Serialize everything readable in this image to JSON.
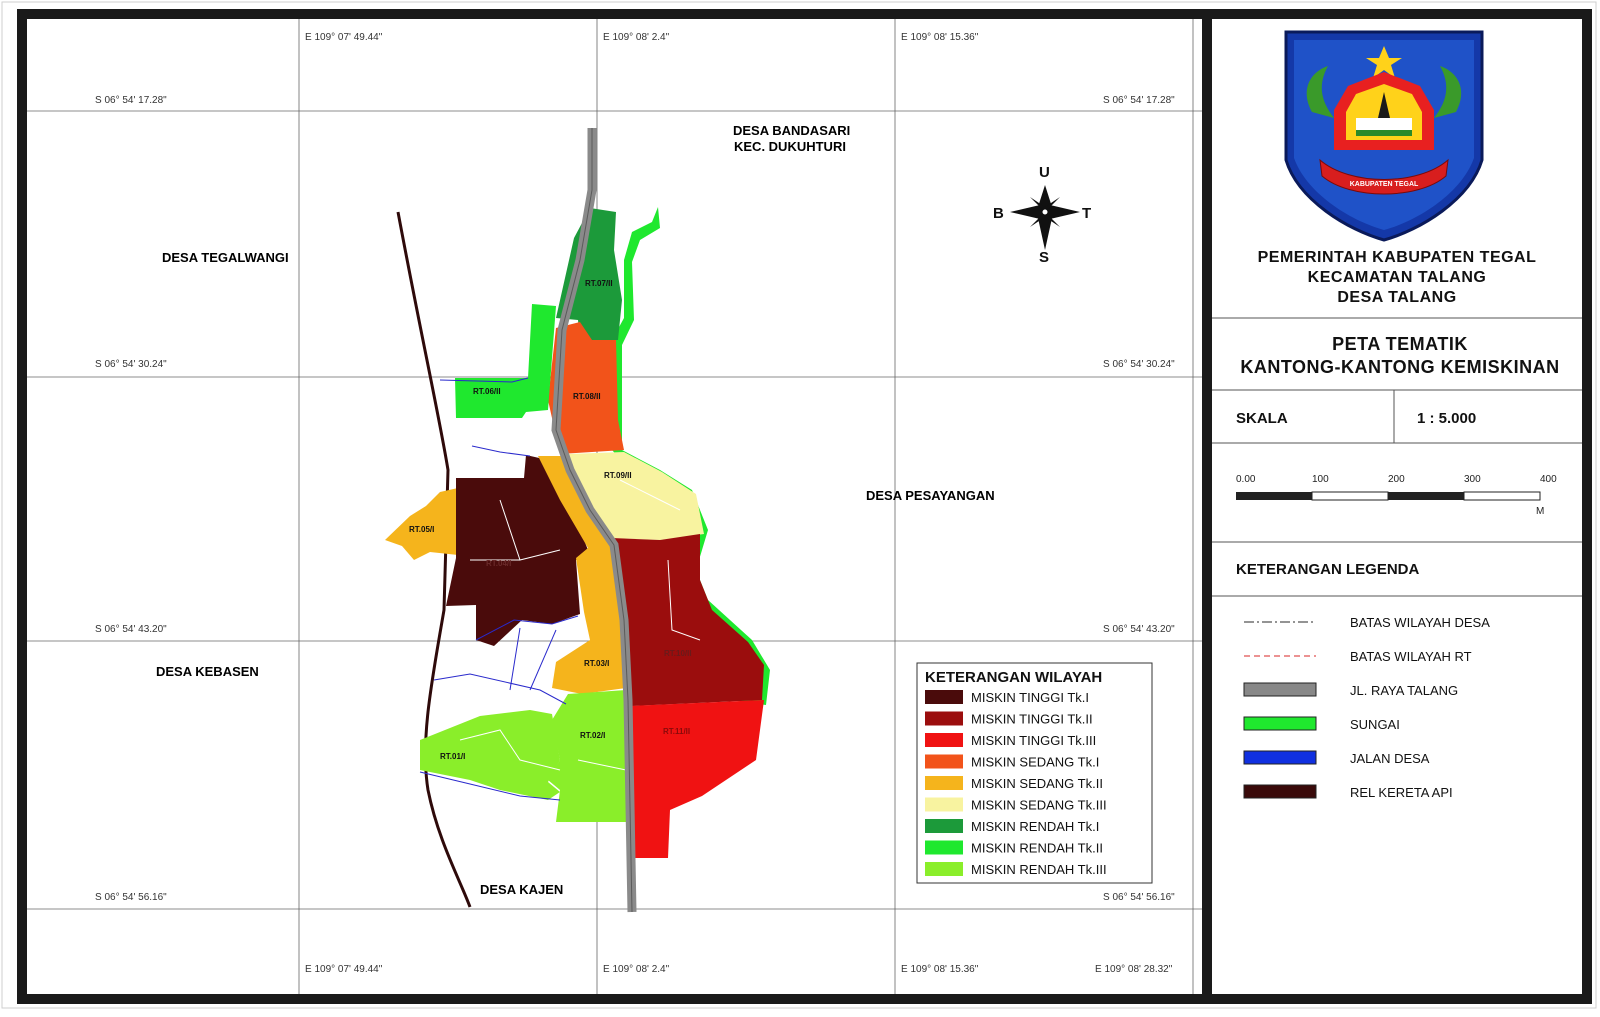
{
  "map": {
    "coordinates": {
      "top_longitudes": [
        "E 109° 07' 49.44\"",
        "E 109° 08' 2.4\"",
        "E 109° 08' 15.36\""
      ],
      "bottom_longitudes": [
        "E 109° 07' 49.44\"",
        "E 109° 08' 2.4\"",
        "E 109° 08' 15.36\"",
        "E 109° 08' 28.32\""
      ],
      "latitudes": [
        "S 06° 54' 17.28\"",
        "S 06° 54' 30.24\"",
        "S 06° 54' 43.20\"",
        "S 06° 54' 56.16\""
      ]
    },
    "villages": {
      "north_line1": "DESA BANDASARI",
      "north_line2": "KEC. DUKUHTURI",
      "west": "DESA TEGALWANGI",
      "east": "DESA PESAYANGAN",
      "southwest": "DESA KEBASEN",
      "south": "DESA KAJEN"
    },
    "rt_labels": {
      "rt07": "RT.07/II",
      "rt08": "RT.08/II",
      "rt06": "RT.06/II",
      "rt09": "RT.09/II",
      "rt05": "RT.05/I",
      "rt04": "RT.04/I",
      "rt10": "RT.10/II",
      "rt03": "RT.03/I",
      "rt11": "RT.11/II",
      "rt02": "RT.02/I",
      "rt01": "RT.01/I"
    },
    "compass": {
      "north": "U",
      "south": "S",
      "west": "B",
      "east": "T"
    }
  },
  "wilayah_legend": {
    "title": "KETERANGAN WILAYAH",
    "items": [
      {
        "label": "MISKIN TINGGI Tk.I",
        "color": "#4a0b0b"
      },
      {
        "label": "MISKIN TINGGI Tk.II",
        "color": "#9b0d0d"
      },
      {
        "label": "MISKIN TINGGI Tk.III",
        "color": "#f01212"
      },
      {
        "label": "MISKIN SEDANG Tk.I",
        "color": "#f2531a"
      },
      {
        "label": "MISKIN SEDANG Tk.II",
        "color": "#f5b41c"
      },
      {
        "label": "MISKIN SEDANG Tk.III",
        "color": "#f8f3a0"
      },
      {
        "label": "MISKIN RENDAH Tk.I",
        "color": "#1c9a3a"
      },
      {
        "label": "MISKIN RENDAH Tk.II",
        "color": "#1fe82e"
      },
      {
        "label": "MISKIN RENDAH Tk.III",
        "color": "#8aee2a"
      }
    ]
  },
  "panel": {
    "gov_line1": "PEMERINTAH KABUPATEN TEGAL",
    "gov_line2": "KECAMATAN TALANG",
    "gov_line3": "DESA TALANG",
    "logo_ribbon": "KABUPATEN TEGAL",
    "map_title_line1": "PETA TEMATIK",
    "map_title_line2": "KANTONG-KANTONG KEMISKINAN",
    "scale_label": "SKALA",
    "scale_value": "1 : 5.000",
    "scale_ticks": [
      "0.00",
      "100",
      "200",
      "300",
      "400"
    ],
    "scale_unit": "M",
    "legend_title": "KETERANGAN LEGENDA",
    "legend_items": [
      {
        "label": "BATAS WILAYAH DESA",
        "style": "dash-dot",
        "color": "#555555"
      },
      {
        "label": "BATAS WILAYAH RT",
        "style": "dashed",
        "color": "#e05050"
      },
      {
        "label": "JL. RAYA TALANG",
        "style": "box",
        "color": "#888888"
      },
      {
        "label": "SUNGAI",
        "style": "box",
        "color": "#1fe82e"
      },
      {
        "label": "JALAN DESA",
        "style": "box",
        "color": "#1030e0"
      },
      {
        "label": "REL KERETA API",
        "style": "box",
        "color": "#3a0a0a"
      }
    ]
  }
}
